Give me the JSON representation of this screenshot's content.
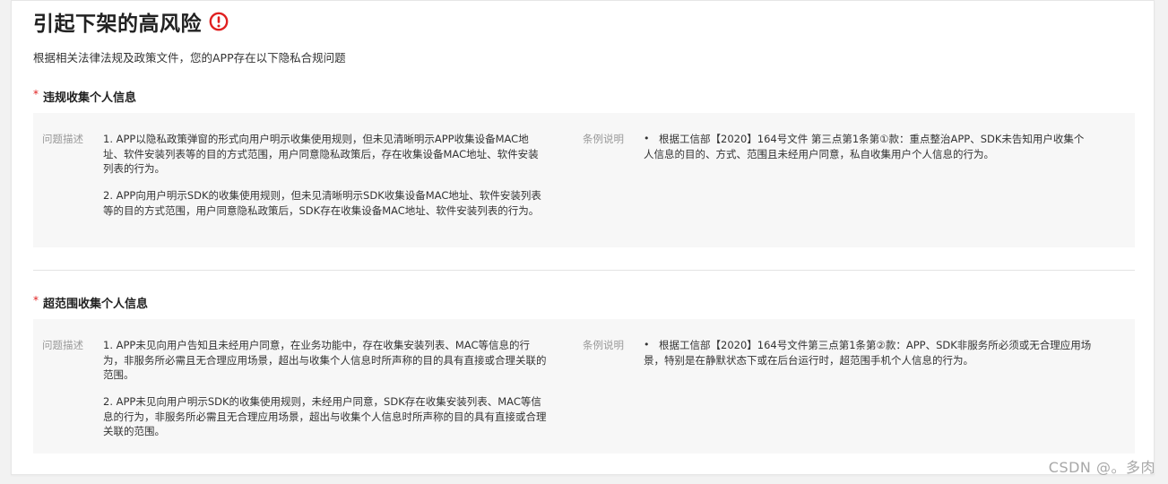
{
  "header": {
    "title": "引起下架的高风险",
    "subtitle": "根据相关法律法规及政策文件，您的APP存在以下隐私合规问题",
    "warning_icon": "exclamation-circle-icon",
    "warning_color": "#e02020"
  },
  "sections": [
    {
      "required_mark": "*",
      "title": "违规收集个人信息",
      "problem_label": "问题描述",
      "problems": [
        "1. APP以隐私政策弹窗的形式向用户明示收集使用规则，但未见清晰明示APP收集设备MAC地址、软件安装列表等的目的方式范围，用户同意隐私政策后，存在收集设备MAC地址、软件安装列表的行为。",
        "2. APP向用户明示SDK的收集使用规则，但未见清晰明示SDK收集设备MAC地址、软件安装列表等的目的方式范围，用户同意隐私政策后，SDK存在收集设备MAC地址、软件安装列表的行为。"
      ],
      "clause_label": "条例说明",
      "bullet": "•",
      "clause": "根据工信部【2020】164号文件 第三点第1条第①款：重点整治APP、SDK未告知用户收集个人信息的目的、方式、范围且未经用户同意，私自收集用户个人信息的行为。"
    },
    {
      "required_mark": "*",
      "title": "超范围收集个人信息",
      "problem_label": "问题描述",
      "problems": [
        "1. APP未见向用户告知且未经用户同意，在业务功能中，存在收集安装列表、MAC等信息的行为，非服务所必需且无合理应用场景，超出与收集个人信息时所声称的目的具有直接或合理关联的范围。",
        "2. APP未见向用户明示SDK的收集使用规则，未经用户同意，SDK存在收集安装列表、MAC等信息的行为，非服务所必需且无合理应用场景，超出与收集个人信息时所声称的目的具有直接或合理关联的范围。"
      ],
      "clause_label": "条例说明",
      "bullet": "•",
      "clause": "根据工信部【2020】164号文件第三点第1条第②款：APP、SDK非服务所必须或无合理应用场景，特别是在静默状态下或在后台运行时，超范围手机个人信息的行为。"
    }
  ],
  "watermark": "CSDN @。多肉"
}
